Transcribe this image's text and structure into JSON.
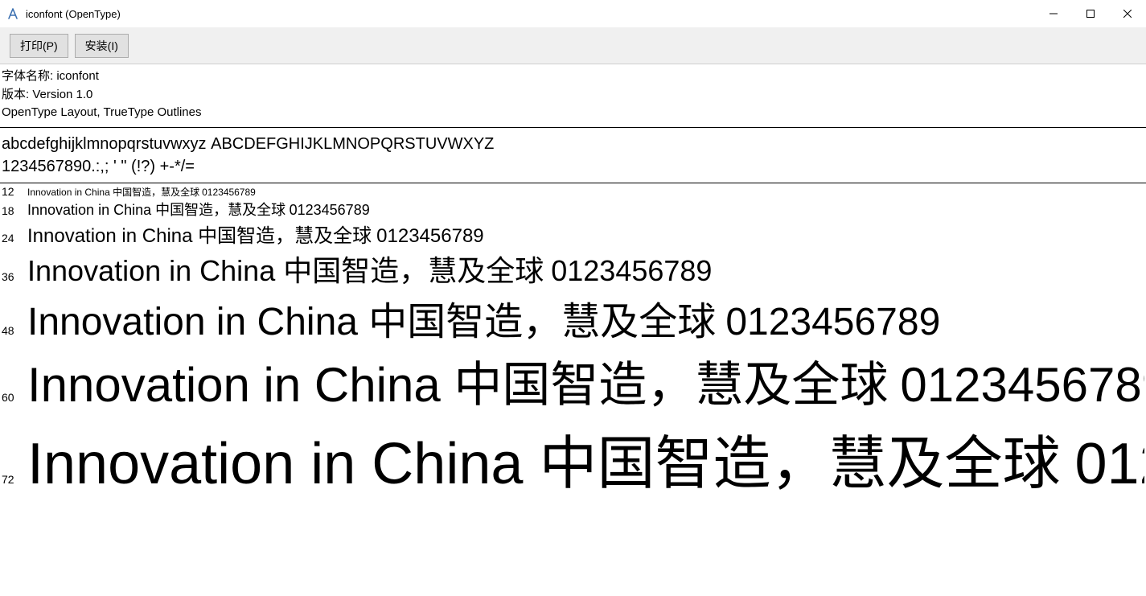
{
  "window": {
    "title": "iconfont (OpenType)"
  },
  "toolbar": {
    "print_label": "打印(P)",
    "install_label": "安装(I)"
  },
  "info": {
    "name_label": "字体名称:",
    "name_value": "iconfont",
    "version_label": "版本:",
    "version_value": "Version 1.0",
    "layout_text": "OpenType Layout, TrueType Outlines"
  },
  "charset": {
    "lowercase": "abcdefghijklmnopqrstuvwxyz",
    "uppercase": "ABCDEFGHIJKLMNOPQRSTUVWXYZ",
    "digits_symbols": "1234567890.:,; ' \" (!?) +-*/="
  },
  "sample": {
    "latin": "Innovation in China",
    "cjk": "中国智造，慧及全球",
    "digits": "0123456789",
    "sizes": [
      12,
      18,
      24,
      36,
      48,
      60,
      72
    ]
  }
}
